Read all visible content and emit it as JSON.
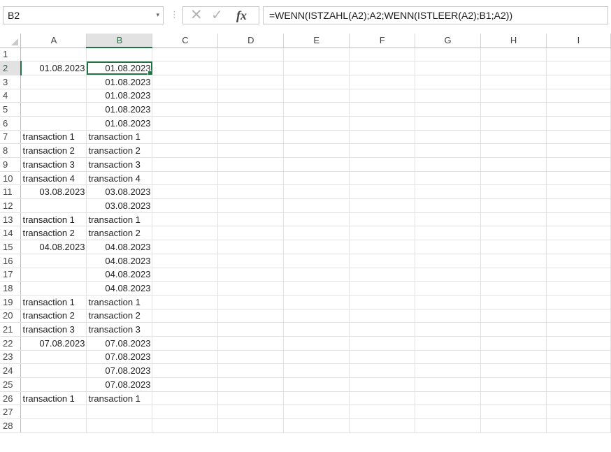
{
  "formula_bar": {
    "name_box": "B2",
    "name_box_arrow": "▾",
    "separator": "⋮",
    "cancel_glyph": "✕",
    "enter_glyph": "✓",
    "fx_label": "fx",
    "formula": "=WENN(ISTZAHL(A2);A2;WENN(ISTLEER(A2);B1;A2))"
  },
  "active_cell": "B2",
  "accent_color": "#217346",
  "columns": [
    "A",
    "B",
    "C",
    "D",
    "E",
    "F",
    "G",
    "H",
    "I"
  ],
  "rows": [
    {
      "n": "1",
      "a": "",
      "b": ""
    },
    {
      "n": "2",
      "a": "01.08.2023",
      "b": "01.08.2023"
    },
    {
      "n": "3",
      "a": "",
      "b": "01.08.2023"
    },
    {
      "n": "4",
      "a": "",
      "b": "01.08.2023"
    },
    {
      "n": "5",
      "a": "",
      "b": "01.08.2023"
    },
    {
      "n": "6",
      "a": "",
      "b": "01.08.2023"
    },
    {
      "n": "7",
      "a": "transaction 1",
      "b": "transaction 1"
    },
    {
      "n": "8",
      "a": "transaction 2",
      "b": "transaction 2"
    },
    {
      "n": "9",
      "a": "transaction 3",
      "b": "transaction 3"
    },
    {
      "n": "10",
      "a": "transaction 4",
      "b": "transaction 4"
    },
    {
      "n": "11",
      "a": "03.08.2023",
      "b": "03.08.2023"
    },
    {
      "n": "12",
      "a": "",
      "b": "03.08.2023"
    },
    {
      "n": "13",
      "a": "transaction 1",
      "b": "transaction 1"
    },
    {
      "n": "14",
      "a": "transaction 2",
      "b": "transaction 2"
    },
    {
      "n": "15",
      "a": "04.08.2023",
      "b": "04.08.2023"
    },
    {
      "n": "16",
      "a": "",
      "b": "04.08.2023"
    },
    {
      "n": "17",
      "a": "",
      "b": "04.08.2023"
    },
    {
      "n": "18",
      "a": "",
      "b": "04.08.2023"
    },
    {
      "n": "19",
      "a": "transaction 1",
      "b": "transaction 1"
    },
    {
      "n": "20",
      "a": "transaction 2",
      "b": "transaction 2"
    },
    {
      "n": "21",
      "a": "transaction 3",
      "b": "transaction 3"
    },
    {
      "n": "22",
      "a": "07.08.2023",
      "b": "07.08.2023"
    },
    {
      "n": "23",
      "a": "",
      "b": "07.08.2023"
    },
    {
      "n": "24",
      "a": "",
      "b": "07.08.2023"
    },
    {
      "n": "25",
      "a": "",
      "b": "07.08.2023"
    },
    {
      "n": "26",
      "a": "transaction 1",
      "b": "transaction 1"
    },
    {
      "n": "27",
      "a": "",
      "b": ""
    },
    {
      "n": "28",
      "a": "",
      "b": ""
    }
  ]
}
